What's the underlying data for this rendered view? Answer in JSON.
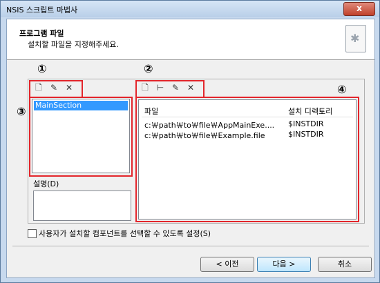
{
  "window": {
    "title": "NSIS 스크립트 마법사",
    "close_glyph": "x"
  },
  "header": {
    "title": "프로그램 파일",
    "subtitle": "설치할 파일을 지정해주세요.",
    "image_glyph": "✱"
  },
  "annotations": {
    "n1": "①",
    "n2": "②",
    "n3": "③",
    "n4": "④"
  },
  "section_toolbar": {
    "new_icon": "🗋",
    "edit_icon": "✎",
    "delete_icon": "✕"
  },
  "file_toolbar": {
    "new_icon": "🗋",
    "tree_icon": "⊢",
    "edit_icon": "✎",
    "delete_icon": "✕"
  },
  "sections": {
    "items": [
      "MainSection"
    ]
  },
  "files": {
    "columns": [
      "파일",
      "설치 디렉토리"
    ],
    "rows": [
      {
        "file": "c:￦path￦to￦file￦AppMainExe....",
        "dir": "$INSTDIR"
      },
      {
        "file": "c:￦path￦to￦file￦Example.file",
        "dir": "$INSTDIR"
      }
    ]
  },
  "description": {
    "label": "설명(D)"
  },
  "options": {
    "checkbox_label": "사용자가 설치할 컴포넌트를 선택할 수 있도록 설정(S)",
    "checked": false
  },
  "buttons": {
    "back": "< 이전",
    "next": "다음 >",
    "cancel": "취소"
  },
  "colors": {
    "annotation": "#e3252b",
    "selection": "#3399ff"
  }
}
